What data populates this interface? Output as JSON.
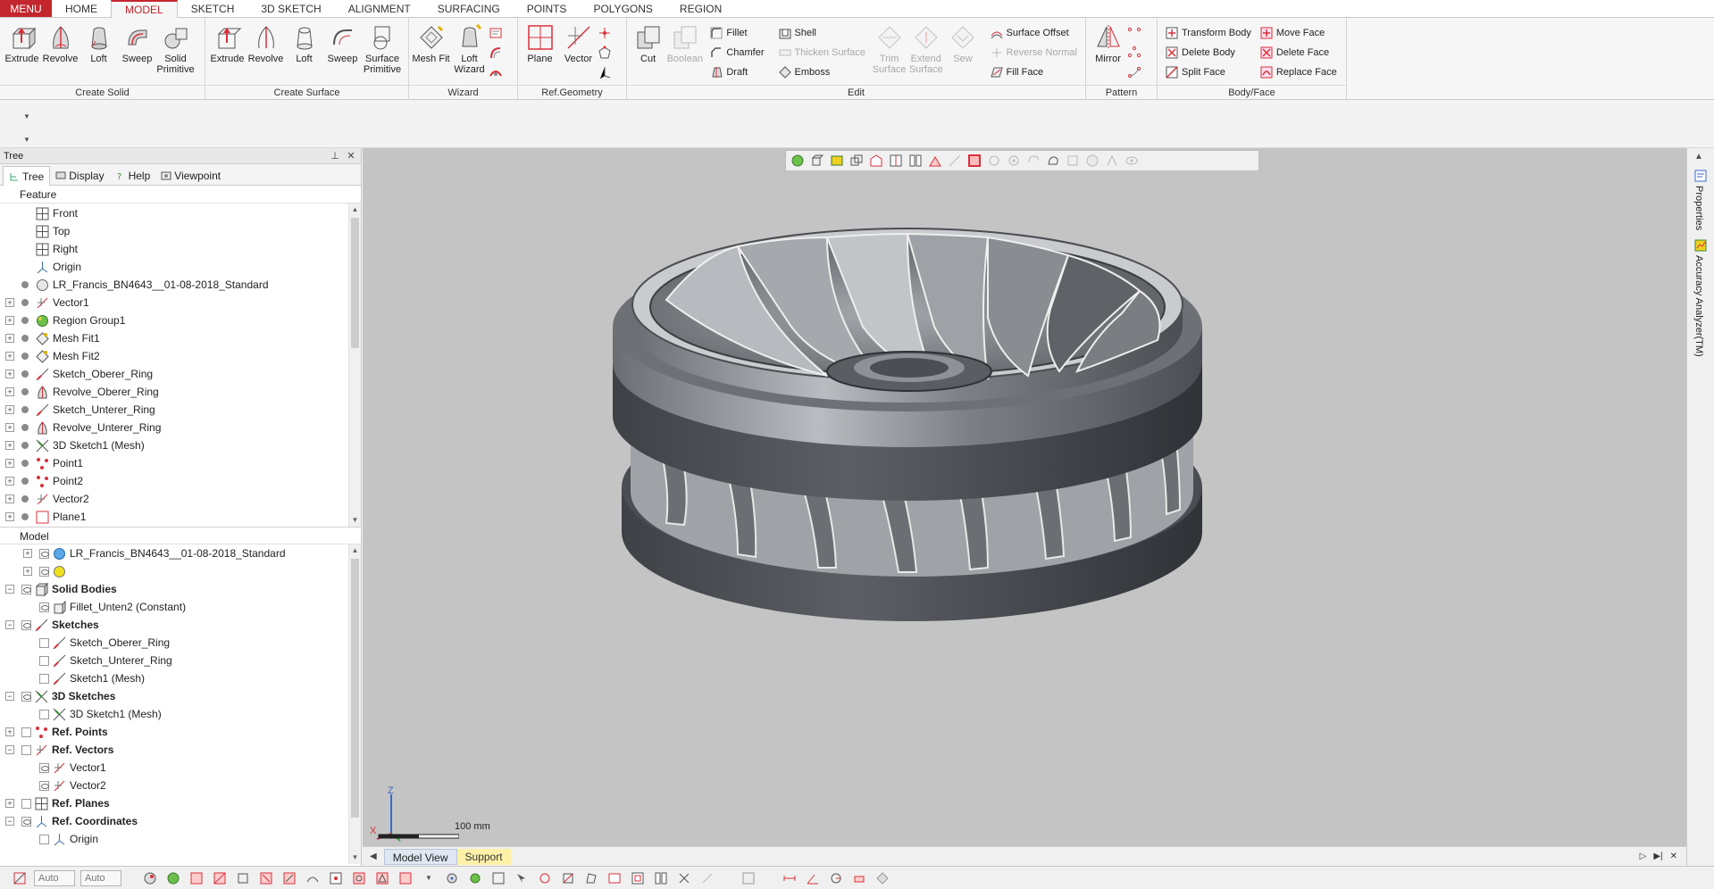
{
  "menubar": {
    "menu_label": "MENU",
    "tabs": [
      "HOME",
      "MODEL",
      "SKETCH",
      "3D SKETCH",
      "ALIGNMENT",
      "SURFACING",
      "POINTS",
      "POLYGONS",
      "REGION"
    ],
    "active_tab": "MODEL"
  },
  "ribbon": {
    "create_solid": {
      "title": "Create Solid",
      "buttons": [
        "Extrude",
        "Revolve",
        "Loft",
        "Sweep",
        "Solid Primitive"
      ]
    },
    "create_surface": {
      "title": "Create Surface",
      "buttons": [
        "Extrude",
        "Revolve",
        "Loft",
        "Sweep",
        "Surface Primitive"
      ]
    },
    "wizard": {
      "title": "Wizard",
      "buttons": [
        "Mesh Fit",
        "Loft Wizard"
      ]
    },
    "ref_geometry": {
      "title": "Ref.Geometry",
      "buttons": [
        "Plane",
        "Vector"
      ]
    },
    "edit": {
      "title": "Edit",
      "big": [
        "Cut",
        "Boolean"
      ],
      "col1": [
        "Fillet",
        "Chamfer",
        "Draft"
      ],
      "col2": [
        "Shell",
        "Thicken Surface",
        "Emboss"
      ],
      "big2": [
        "Trim Surface",
        "Extend Surface",
        "Sew"
      ],
      "col3": [
        "Surface Offset",
        "Reverse Normal",
        "Fill Face"
      ]
    },
    "pattern": {
      "title": "Pattern",
      "buttons": [
        "Mirror"
      ]
    },
    "body_face": {
      "title": "Body/Face",
      "col1": [
        "Transform Body",
        "Delete Body",
        "Split Face"
      ],
      "col2": [
        "Move Face",
        "Delete Face",
        "Replace Face"
      ]
    }
  },
  "tree_panel": {
    "title": "Tree",
    "tabs": [
      "Tree",
      "Display",
      "Help",
      "Viewpoint"
    ],
    "feature_title": "Feature",
    "features": [
      "Front",
      "Top",
      "Right",
      "Origin",
      "LR_Francis_BN4643__01-08-2018_Standard",
      "Vector1",
      "Region Group1",
      "Mesh Fit1",
      "Mesh Fit2",
      "Sketch_Oberer_Ring",
      "Revolve_Oberer_Ring",
      "Sketch_Unterer_Ring",
      "Revolve_Unterer_Ring",
      "3D Sketch1 (Mesh)",
      "Point1",
      "Point2",
      "Vector2",
      "Plane1"
    ],
    "model_title": "Model",
    "model": [
      "LR_Francis_BN4643__01-08-2018_Standard",
      "",
      "Solid Bodies",
      "Fillet_Unten2 (Constant)",
      "Sketches",
      "Sketch_Oberer_Ring",
      "Sketch_Unterer_Ring",
      "Sketch1 (Mesh)",
      "3D Sketches",
      "3D Sketch1 (Mesh)",
      "Ref. Points",
      "Ref. Vectors",
      "Vector1",
      "Vector2",
      "Ref. Planes",
      "Ref. Coordinates",
      "Origin"
    ]
  },
  "viewport": {
    "scale_label": "100 mm",
    "axis_z": "Z",
    "axis_x": "X",
    "background": "#c4c4c4",
    "model_color": "#8d9094"
  },
  "right_dock": {
    "tabs": [
      "Properties",
      "Accuracy Analyzer(TM)"
    ]
  },
  "view_tabs": {
    "tabs": [
      "Model View",
      "Support"
    ]
  },
  "statusbar": {
    "combo1": "Auto",
    "combo2": "Auto"
  },
  "colors": {
    "accent": "#c4262e",
    "icon_red": "#d8303a",
    "icon_gray": "#8f8f8f"
  }
}
